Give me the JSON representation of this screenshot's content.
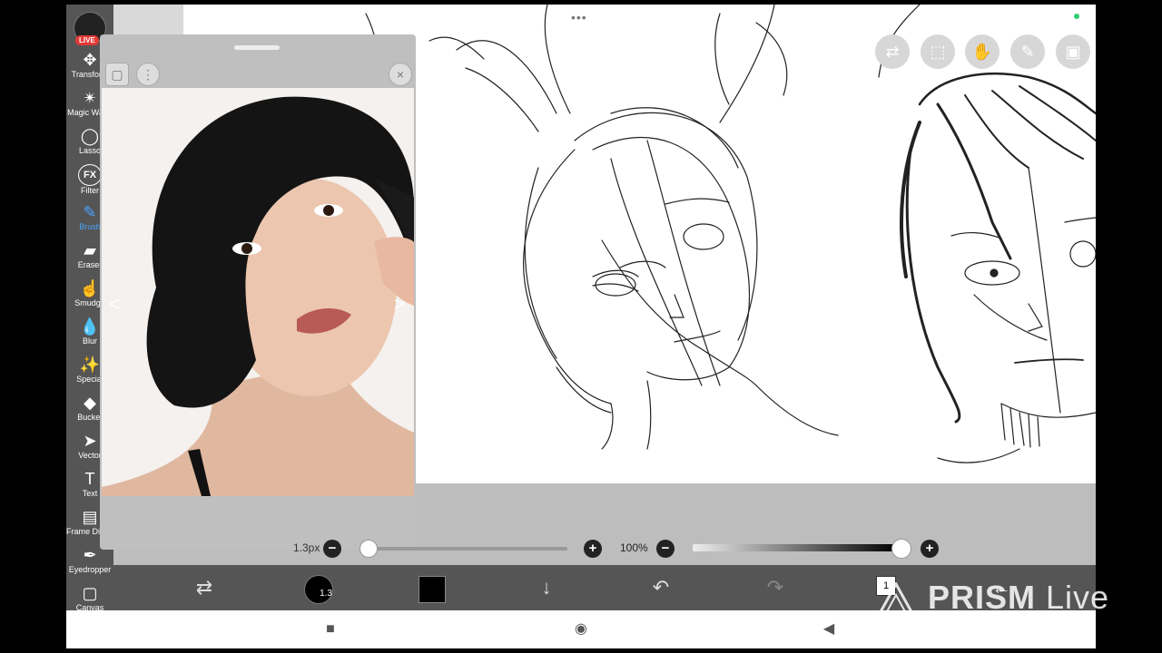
{
  "toolbar": {
    "app_badge": "LIVE",
    "tools": [
      {
        "label": "Transform",
        "icon": "transform-icon",
        "glyph": "✥"
      },
      {
        "label": "Magic Wand",
        "icon": "magic-wand-icon",
        "glyph": "✴"
      },
      {
        "label": "Lasso",
        "icon": "lasso-icon",
        "glyph": "◯"
      },
      {
        "label": "Filter",
        "icon": "filter-icon",
        "glyph": "FX"
      },
      {
        "label": "Brush",
        "icon": "brush-icon",
        "glyph": "✎"
      },
      {
        "label": "Eraser",
        "icon": "eraser-icon",
        "glyph": "▰"
      },
      {
        "label": "Smudge",
        "icon": "smudge-icon",
        "glyph": "☝"
      },
      {
        "label": "Blur",
        "icon": "blur-icon",
        "glyph": "💧"
      },
      {
        "label": "Special",
        "icon": "special-icon",
        "glyph": "✨"
      },
      {
        "label": "Bucket",
        "icon": "bucket-icon",
        "glyph": "◆"
      },
      {
        "label": "Vector",
        "icon": "vector-icon",
        "glyph": "➤"
      },
      {
        "label": "Text",
        "icon": "text-icon",
        "glyph": "T"
      },
      {
        "label": "Frame Divider",
        "icon": "frame-divider-icon",
        "glyph": "▤"
      },
      {
        "label": "Eyedropper",
        "icon": "eyedropper-icon",
        "glyph": "✒"
      },
      {
        "label": "Canvas",
        "icon": "canvas-icon",
        "glyph": "▢"
      }
    ],
    "active_tool": "Brush"
  },
  "reference_window": {
    "prev_arrow": "<",
    "next_arrow": ">",
    "close_glyph": "×",
    "menu_glyph": "⋮"
  },
  "top_right_icons": [
    "layers-toggle-icon",
    "selection-icon",
    "hand-icon",
    "pen-icon",
    "image-icon"
  ],
  "top_dots": "•••",
  "brush": {
    "size_label": "1.3px",
    "size_circle_label": "1.3",
    "opacity_label": "100%",
    "opacity": 1.0
  },
  "bottom_bar": {
    "layer_count": "1"
  },
  "watermark": {
    "brand": "PRISM",
    "suffix": " Live"
  },
  "colors": {
    "toolbar_bg": "#555555",
    "active_accent": "#4aa3ff",
    "live_red": "#e53935",
    "swatch": "#000000"
  }
}
